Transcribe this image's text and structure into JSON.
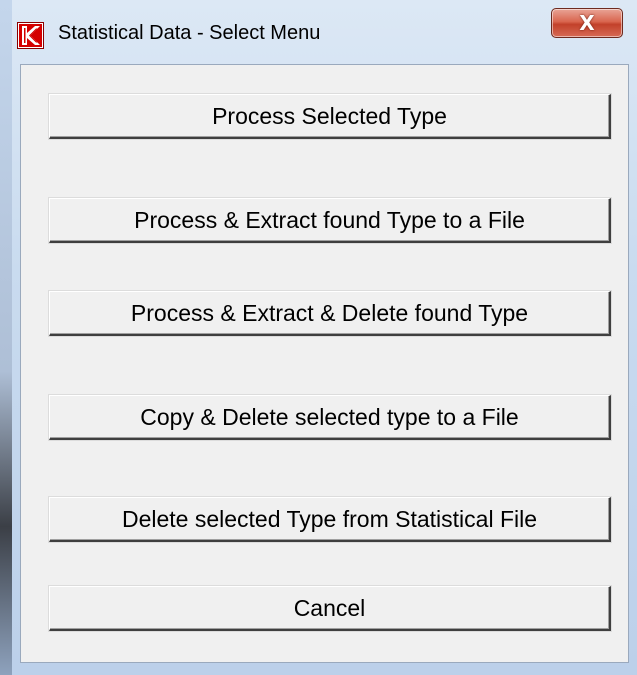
{
  "window": {
    "title": "Statistical Data - Select Menu",
    "app_icon": "k-logo-icon",
    "close_glyph": "X",
    "accent_color": "#cc0000"
  },
  "menu": {
    "buttons": [
      {
        "label": "Process Selected Type"
      },
      {
        "label": "Process & Extract found Type to a File"
      },
      {
        "label": "Process & Extract & Delete found Type"
      },
      {
        "label": "Copy & Delete selected type to a File"
      },
      {
        "label": "Delete selected Type from Statistical File"
      },
      {
        "label": "Cancel"
      }
    ]
  }
}
